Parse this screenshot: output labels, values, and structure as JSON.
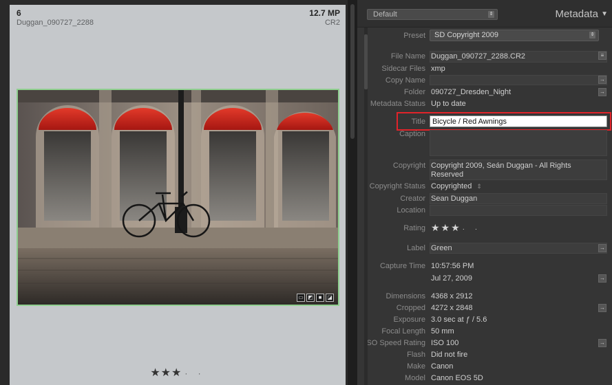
{
  "loupe": {
    "index": "6",
    "filename": "Duggan_090727_2288",
    "megapixels": "12.7 MP",
    "extension": "CR2",
    "stars": "★★★",
    "unrated_dots": "· ·"
  },
  "panel": {
    "header_preset": "Default",
    "title": "Metadata"
  },
  "metadata": {
    "preset": {
      "label": "Preset",
      "value": "SD Copyright 2009"
    },
    "file_name": {
      "label": "File Name",
      "value": "Duggan_090727_2288.CR2"
    },
    "sidecar_files": {
      "label": "Sidecar Files",
      "value": "xmp"
    },
    "copy_name": {
      "label": "Copy Name",
      "value": ""
    },
    "folder": {
      "label": "Folder",
      "value": "090727_Dresden_Night"
    },
    "metadata_status": {
      "label": "Metadata Status",
      "value": "Up to date"
    },
    "title": {
      "label": "Title",
      "value": "Bicycle / Red Awnings"
    },
    "caption": {
      "label": "Caption",
      "value": ""
    },
    "copyright": {
      "label": "Copyright",
      "value": "Copyright 2009, Seán Duggan - All Rights Reserved"
    },
    "copyright_status": {
      "label": "Copyright Status",
      "value": "Copyrighted"
    },
    "creator": {
      "label": "Creator",
      "value": "Sean Duggan"
    },
    "location": {
      "label": "Location",
      "value": ""
    },
    "rating": {
      "label": "Rating",
      "value": "★★★",
      "dots": "· ·"
    },
    "label": {
      "label": "Label",
      "value": "Green"
    },
    "capture_time": {
      "label": "Capture Time",
      "time": "10:57:56 PM",
      "date": "Jul 27, 2009"
    },
    "dimensions": {
      "label": "Dimensions",
      "value": "4368 x 2912"
    },
    "cropped": {
      "label": "Cropped",
      "value": "4272 x 2848"
    },
    "exposure": {
      "label": "Exposure",
      "value": "3.0 sec at ƒ / 5.6"
    },
    "focal_length": {
      "label": "Focal Length",
      "value": "50 mm"
    },
    "iso": {
      "label": "ISO Speed Rating",
      "value": "ISO 100"
    },
    "flash": {
      "label": "Flash",
      "value": "Did not fire"
    },
    "make": {
      "label": "Make",
      "value": "Canon"
    },
    "model": {
      "label": "Model",
      "value": "Canon EOS 5D"
    }
  },
  "icons": {
    "select_arrow": "updown-arrow-icon",
    "side_button": "arrow-right-icon",
    "list_button": "list-icon",
    "collapse": "triangle-down-icon"
  },
  "colors": {
    "highlight_red": "#e2232a",
    "selection_green": "#8fcf8f",
    "awning_red": "#c8201c"
  }
}
